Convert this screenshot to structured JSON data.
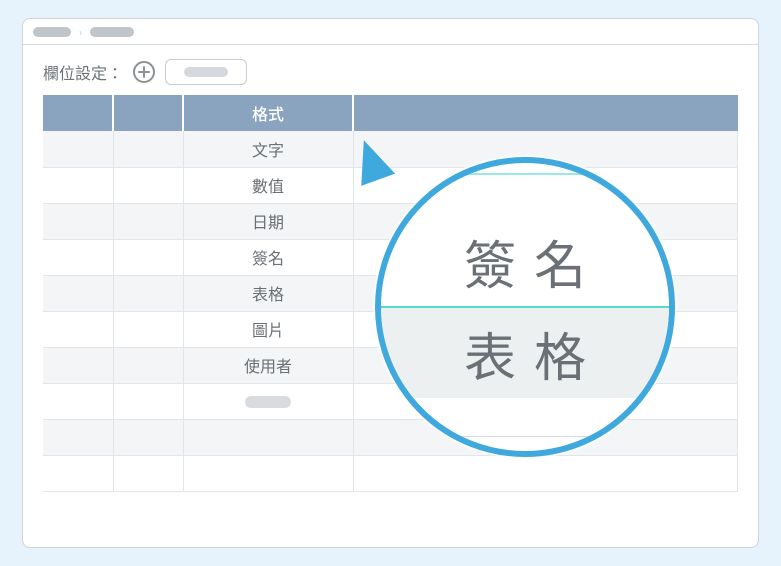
{
  "toolbar": {
    "label": "欄位設定："
  },
  "table": {
    "columns": [
      "",
      "",
      "格式",
      ""
    ],
    "format_options": [
      "文字",
      "數值",
      "日期",
      "簽名",
      "表格",
      "圖片",
      "使用者"
    ]
  },
  "magnifier": {
    "option_a": "簽名",
    "option_b": "表格"
  }
}
